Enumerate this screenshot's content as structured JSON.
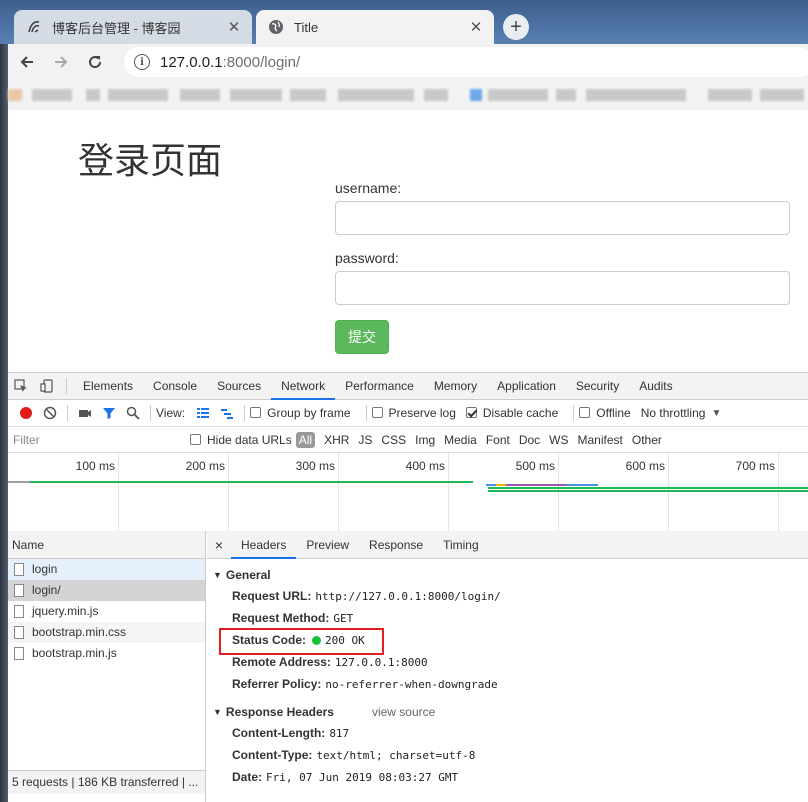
{
  "tabs": [
    {
      "title": "博客后台管理 - 博客园",
      "close": "✕"
    },
    {
      "title": "Title",
      "close": "✕"
    }
  ],
  "new_tab": "+",
  "address": {
    "host": "127.0.0.1",
    "path": ":8000/login/",
    "info": "i"
  },
  "page": {
    "heading": "登录页面",
    "username_label": "username:",
    "password_label": "password:",
    "submit_label": "提交"
  },
  "devtools": {
    "panels": [
      "Elements",
      "Console",
      "Sources",
      "Network",
      "Performance",
      "Memory",
      "Application",
      "Security",
      "Audits"
    ],
    "active_panel": "Network",
    "toolbar": {
      "view_label": "View:",
      "group_by_frame": "Group by frame",
      "preserve_log": "Preserve log",
      "disable_cache": "Disable cache",
      "offline": "Offline",
      "throttling": "No throttling"
    },
    "filter": {
      "placeholder": "Filter",
      "hide_data_urls": "Hide data URLs",
      "all": "All",
      "types": [
        "XHR",
        "JS",
        "CSS",
        "Img",
        "Media",
        "Font",
        "Doc",
        "WS",
        "Manifest",
        "Other"
      ]
    },
    "timeline_labels": [
      "100 ms",
      "200 ms",
      "300 ms",
      "400 ms",
      "500 ms",
      "600 ms",
      "700 ms"
    ],
    "requests": {
      "header": "Name",
      "items": [
        "login",
        "login/",
        "jquery.min.js",
        "bootstrap.min.css",
        "bootstrap.min.js"
      ],
      "footer": "5 requests | 186 KB transferred | ..."
    },
    "detail": {
      "close": "×",
      "tabs": [
        "Headers",
        "Preview",
        "Response",
        "Timing"
      ],
      "general_title": "General",
      "general": [
        {
          "key": "Request URL:",
          "value": "http://127.0.0.1:8000/login/"
        },
        {
          "key": "Request Method:",
          "value": "GET"
        },
        {
          "key": "Status Code:",
          "value": "200 OK"
        },
        {
          "key": "Remote Address:",
          "value": "127.0.0.1:8000"
        },
        {
          "key": "Referrer Policy:",
          "value": "no-referrer-when-downgrade"
        }
      ],
      "response_title": "Response Headers",
      "view_source": "view source",
      "response": [
        {
          "key": "Content-Length:",
          "value": "817"
        },
        {
          "key": "Content-Type:",
          "value": "text/html; charset=utf-8"
        },
        {
          "key": "Date:",
          "value": "Fri, 07 Jun 2019 08:03:27 GMT"
        }
      ]
    }
  },
  "colors": {
    "accent": "#1a73e8",
    "success_button": "#5cb85c",
    "status_ok": "#17c234",
    "record": "#e21b1b",
    "highlight": "#e02020"
  }
}
